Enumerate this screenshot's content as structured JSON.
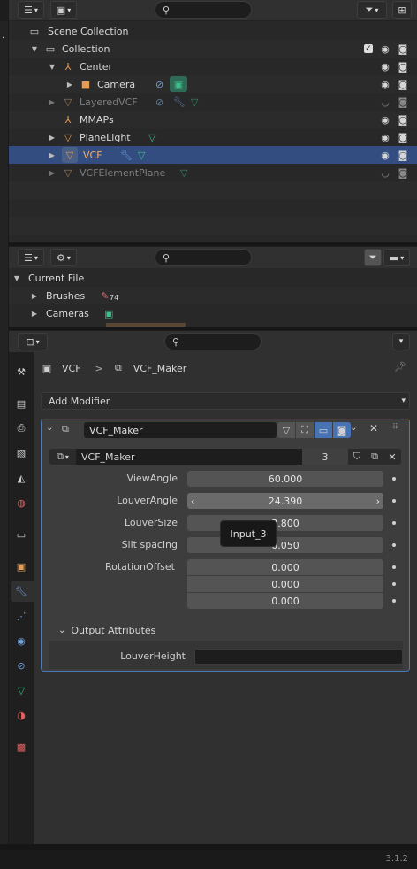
{
  "outliner": {
    "rows": [
      {
        "label": "Scene Collection"
      },
      {
        "label": "Collection"
      },
      {
        "label": "Center"
      },
      {
        "label": "Camera"
      },
      {
        "label": "LayeredVCF"
      },
      {
        "label": "MMAPs"
      },
      {
        "label": "PlaneLight"
      },
      {
        "label": "VCF"
      },
      {
        "label": "VCFElementPlane"
      }
    ]
  },
  "file_browser": {
    "current_file": "Current File",
    "items": [
      {
        "label": "Brushes",
        "badge": "74"
      },
      {
        "label": "Cameras"
      }
    ]
  },
  "properties": {
    "breadcrumb": {
      "object": "VCF",
      "separator": ">",
      "modifier": "VCF_Maker"
    },
    "add_modifier": "Add Modifier",
    "modifier": {
      "name": "VCF_Maker",
      "node_group": "VCF_Maker",
      "users": "3",
      "inputs": [
        {
          "label": "ViewAngle",
          "value": "60.000"
        },
        {
          "label": "LouverAngle",
          "value": "24.390"
        },
        {
          "label": "LouverSize",
          "value": "3.800"
        },
        {
          "label": "Slit spacing",
          "value": "0.050"
        },
        {
          "label": "RotationOffset",
          "value": "0.000"
        },
        {
          "label": "",
          "value": "0.000"
        },
        {
          "label": "",
          "value": "0.000"
        }
      ],
      "tooltip": "Input_3",
      "output_section": "Output Attributes",
      "outputs": [
        {
          "label": "LouverHeight",
          "value": ""
        }
      ]
    }
  },
  "status_bar": {
    "version": "3.1.2"
  },
  "colors": {
    "selection": "#334d80",
    "object_orange": "#e39c52",
    "modifier_blue": "#6e9ed8",
    "data_green": "#3cbf8a",
    "panel_border": "#4a79b5"
  }
}
